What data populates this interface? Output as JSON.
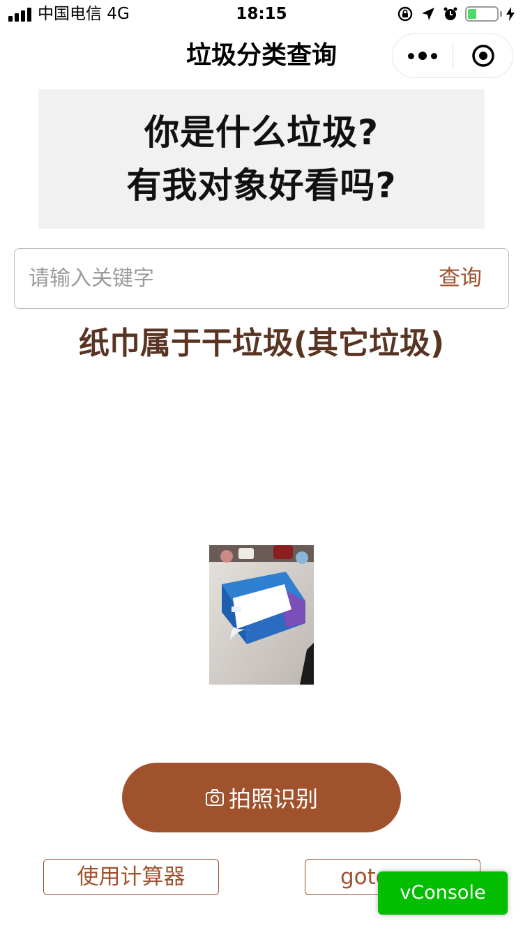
{
  "status_bar": {
    "carrier": "中国电信   4G",
    "time": "18:15",
    "battery_level": 0.3
  },
  "nav": {
    "title": "垃圾分类查询"
  },
  "banner": {
    "line1": "你是什么垃圾?",
    "line2": "有我对象好看吗?"
  },
  "search": {
    "placeholder": "请输入关键字",
    "button_label": "查询"
  },
  "result": {
    "text": "纸巾属于干垃圾(其它垃圾)"
  },
  "camera_button": {
    "label": "拍照识别",
    "icon": "camera-icon"
  },
  "footer": {
    "calc_label": "使用计算器",
    "goto_label": "goto"
  },
  "vconsole": {
    "label": "vConsole"
  },
  "colors": {
    "accent": "#a0522d",
    "result_text": "#5a3422",
    "vconsole_green": "#04be02",
    "battery_green": "#4cd964"
  }
}
